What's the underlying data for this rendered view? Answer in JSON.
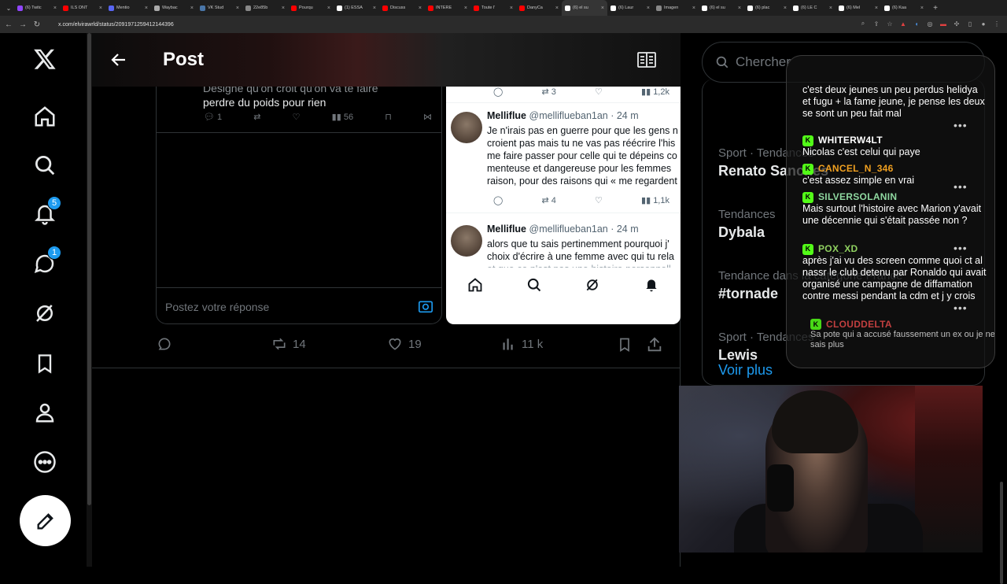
{
  "browser": {
    "tabs": [
      {
        "label": "(6) Twitc",
        "color": "#9146ff"
      },
      {
        "label": "ILS ONT",
        "color": "#ff0000"
      },
      {
        "label": "Mentio",
        "color": "#5865f2"
      },
      {
        "label": "Waybac",
        "color": "#aaaaaa"
      },
      {
        "label": "VK Stud",
        "color": "#4a76a8"
      },
      {
        "label": "22e85b",
        "color": "#888888"
      },
      {
        "label": "Pourqu",
        "color": "#ff0000"
      },
      {
        "label": "(1) ESSA",
        "color": "#ffffff"
      },
      {
        "label": "Discuss",
        "color": "#ff0000"
      },
      {
        "label": "INTERE",
        "color": "#ff0000"
      },
      {
        "label": "Toute l'",
        "color": "#ff0000"
      },
      {
        "label": "DanyCa",
        "color": "#ff0000"
      },
      {
        "label": "(6) el su",
        "color": "#ffffff",
        "active": true
      },
      {
        "label": "(6) Laur",
        "color": "#ffffff"
      },
      {
        "label": "Imagen",
        "color": "#888888"
      },
      {
        "label": "(6) el su",
        "color": "#ffffff"
      },
      {
        "label": "(6) plac",
        "color": "#ffffff"
      },
      {
        "label": "(6) LE C",
        "color": "#ffffff"
      },
      {
        "label": "(6) Mel",
        "color": "#ffffff"
      },
      {
        "label": "(6) Kaa",
        "color": "#ffffff"
      }
    ],
    "url": "x.com/elvirawrld/status/2091971259412144396"
  },
  "nav": {
    "notifications_badge": "5",
    "messages_badge": "1"
  },
  "header": {
    "title": "Post"
  },
  "shot1": {
    "text_line1": "Désigne qu'on croit qu'on va te faire",
    "text_line2": "perdre du poids pour rien",
    "replies": "1",
    "views": "56",
    "reply_placeholder": "Postez votre réponse"
  },
  "shot2": {
    "top_retweets": "3",
    "top_views": "1,2k",
    "tweet1": {
      "name": "Melliflue",
      "handle": "@melliflueban1an · 24 m",
      "lines": [
        "Je n'irais pas en guerre pour que les gens n",
        "croient pas mais tu ne vas pas réécrire l'his",
        "me faire passer pour celle qui te dépeins co",
        "menteuse et  dangereuse pour les femmes",
        "raison, pour des raisons qui « me regardent"
      ],
      "retweets": "4",
      "views": "1,1k"
    },
    "tweet2": {
      "name": "Melliflue",
      "handle": "@melliflueban1an · 24 m",
      "lines": [
        "alors que tu sais pertinemment pourquoi j'",
        "choix d'écrire à une femme avec qui tu rela",
        "et que ce n'est pas une histoire personnell"
      ]
    }
  },
  "actions": {
    "retweets": "14",
    "likes": "19",
    "views": "11 k"
  },
  "search": {
    "placeholder": "Chercher"
  },
  "trends": [
    {
      "context": "Sport · Tendances",
      "name": "Renato Sanches"
    },
    {
      "context": "Tendances",
      "name": "Dybala"
    },
    {
      "context": "Tendance dans la catégorie France",
      "name": "#tornade"
    },
    {
      "context": "Sport · Tendances",
      "name": "Lewis"
    }
  ],
  "trends_more": "Voir plus",
  "chat": {
    "messages": [
      {
        "user": "",
        "user_color": "#ffffff",
        "text": "c'est deux jeunes un peu perdus helidya et fugu + la fame jeune, je pense les deux se sont un peu fait mal"
      },
      {
        "user": "WHITERW4LT",
        "user_color": "#ffffff",
        "text": "Nicolas c'est celui qui paye"
      },
      {
        "user": "CANCEL_N_346",
        "user_color": "#f0a020",
        "text": "c'est assez simple en vrai"
      },
      {
        "user": "SILVERSOLANIN",
        "user_color": "#8fd8a0",
        "text": "Mais surtout l'histoire avec Marion y'avait une décennie qui s'était passée non ?"
      },
      {
        "user": "POX_XD",
        "user_color": "#8fd060",
        "text": "après j'ai vu des screen comme quoi ct al nassr le club detenu par Ronaldo qui avait organisé une campagne de diffamation contre messi pendant la cdm et j y crois"
      },
      {
        "user": "CLOUDDELTA",
        "user_color": "#e04848",
        "text": "Sa pote qui a accusé faussement un ex ou je ne sais plus"
      }
    ]
  }
}
